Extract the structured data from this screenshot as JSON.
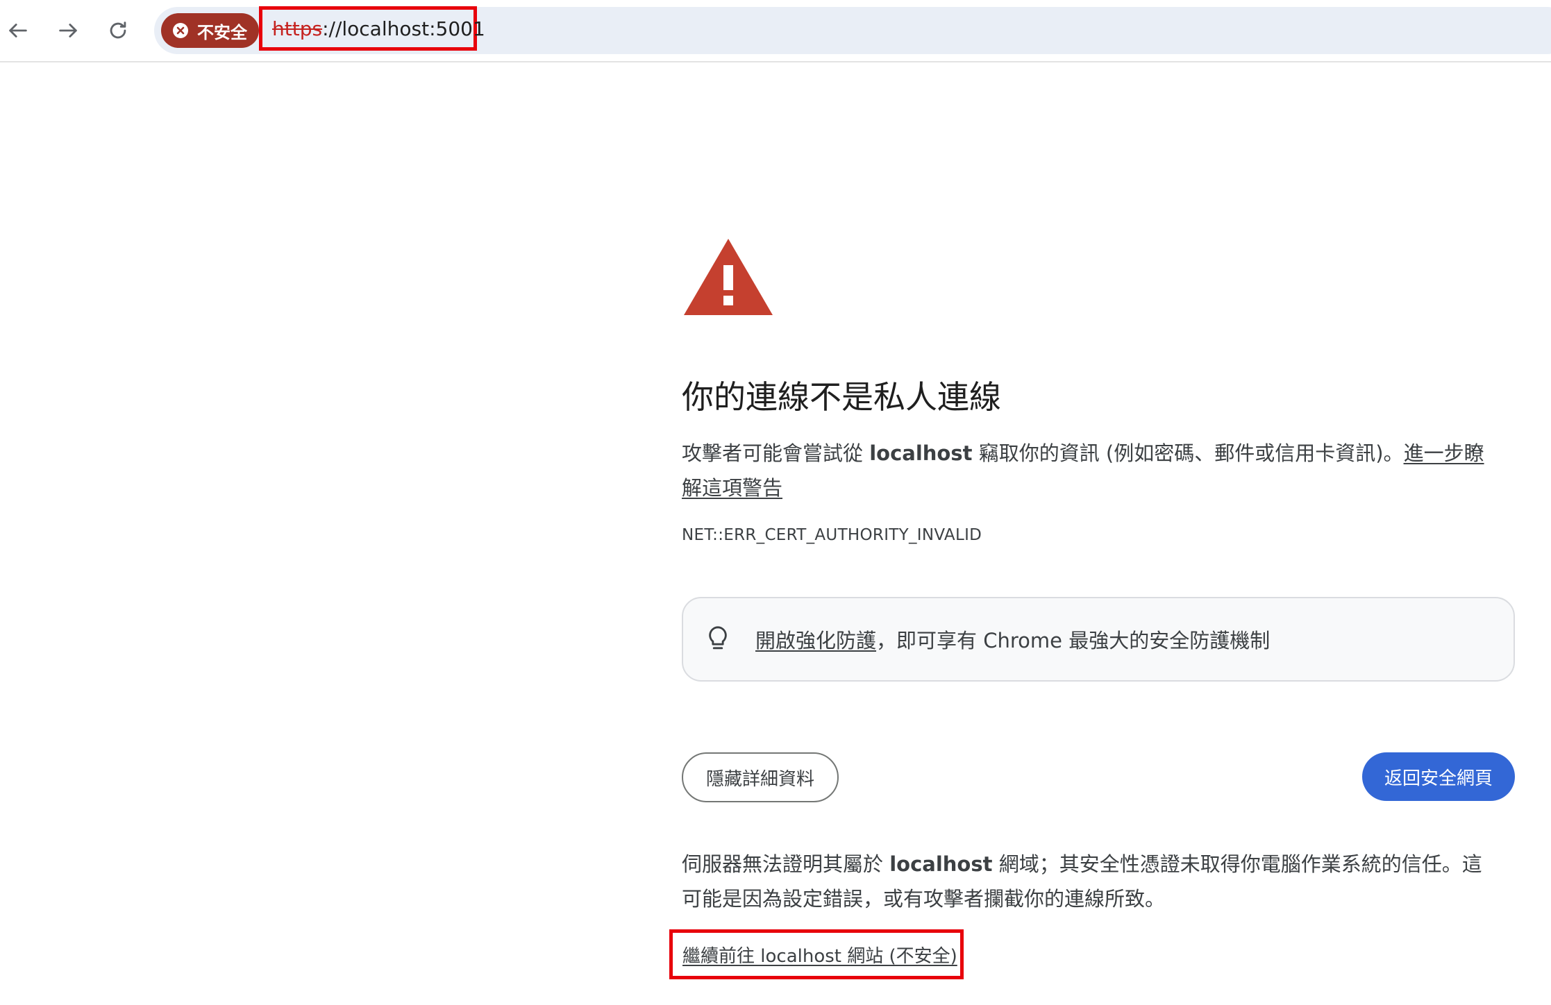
{
  "browser": {
    "security_chip": {
      "label": "不安全",
      "color": "#a03226"
    },
    "url": {
      "scheme": "https",
      "rest": "://localhost:5001"
    },
    "highlight_color": "#e8000b",
    "icons": {
      "back": "arrow-left-icon",
      "forward": "arrow-right-icon",
      "reload": "reload-icon",
      "chip": "circle-x-icon"
    }
  },
  "interstitial": {
    "heading": "你的連線不是私人連線",
    "description": {
      "before": "攻擊者可能會嘗試從 ",
      "host": "localhost",
      "after": " 竊取你的資訊 (例如密碼、郵件或信用卡資訊)。",
      "learn_more": "進一步瞭解這項警告"
    },
    "error_code": "NET::ERR_CERT_AUTHORITY_INVALID",
    "callout": {
      "link": "開啟強化防護",
      "text": "，即可享有 Chrome 最強大的安全防護機制"
    },
    "buttons": {
      "details": "隱藏詳細資料",
      "back_to_safety": "返回安全網頁",
      "primary_color": "#3367d6"
    },
    "explanation": {
      "before": "伺服器無法證明其屬於 ",
      "host": "localhost",
      "after": " 網域；其安全性憑證未取得你電腦作業系統的信任。這可能是因為設定錯誤，或有攻擊者攔截你的連線所致。"
    },
    "proceed_link": "繼續前往 localhost 網站 (不安全)",
    "warning_color": "#c5402f"
  }
}
